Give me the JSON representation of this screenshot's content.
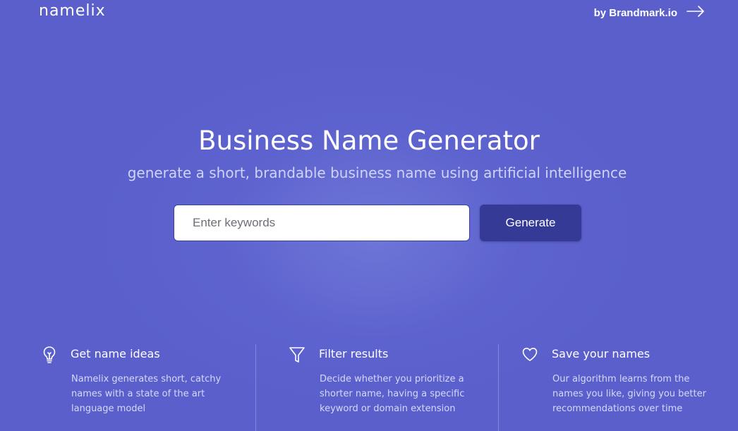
{
  "header": {
    "logo": "namelix",
    "by_link": "by Brandmark.io"
  },
  "hero": {
    "title": "Business Name Generator",
    "subtitle": "generate a short, brandable business name using artificial intelligence",
    "input_placeholder": "Enter keywords",
    "button_label": "Generate"
  },
  "features": [
    {
      "icon": "lightbulb-icon",
      "title": "Get name ideas",
      "description": "Namelix generates short, catchy names with a state of the art language model"
    },
    {
      "icon": "filter-icon",
      "title": "Filter results",
      "description": "Decide whether you prioritize a shorter name, having a specific keyword or domain extension"
    },
    {
      "icon": "heart-icon",
      "title": "Save your names",
      "description": "Our algorithm learns from the names you like, giving you better recommendations over time"
    }
  ],
  "colors": {
    "background": "#5a5fcc",
    "button": "#343a96",
    "subtitle": "#cfd4f7"
  }
}
